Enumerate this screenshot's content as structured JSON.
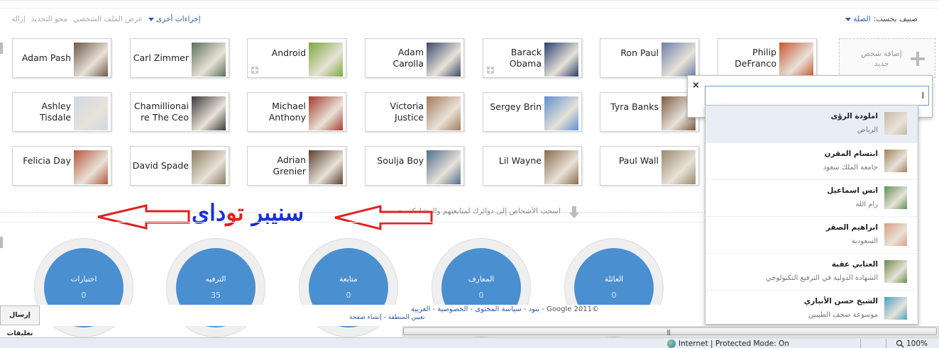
{
  "toolbar": {
    "actions": {
      "more_label": "إجراءات أخرى",
      "remove_label": "إزالة",
      "clear_label": "محو التحديد",
      "view_profile_label": "عرض الملف الشخصي"
    },
    "sort": {
      "label": "صنيف بحسب:",
      "value": "الصلة"
    }
  },
  "people_rows": [
    [
      {
        "name": "Adam Pash",
        "photo": "#6b5a4a"
      },
      {
        "name": "Carl Zimmer",
        "photo": "#5d6f5a"
      },
      {
        "name": "Android",
        "photo": "#7aa83c"
      },
      {
        "name": "Adam Carolla",
        "photo": "#3b4a6a"
      },
      {
        "name": "Barack Obama",
        "photo": "#2a3e70"
      },
      {
        "name": "Ron Paul",
        "photo": "#6a7fa8"
      },
      {
        "name": "Philip DeFranco",
        "photo": "#c7552f"
      }
    ],
    [
      {
        "name": "Ashley Tisdale",
        "photo": "#cfd9e6"
      },
      {
        "name": "Chamillionaire The Ceo",
        "photo": "#3a3a3a"
      },
      {
        "name": "Michael Anthony",
        "photo": "#a73b2e"
      },
      {
        "name": "Victoria Justice",
        "photo": "#a5785a"
      },
      {
        "name": "Sergey Brin",
        "photo": "#5c8fd1"
      },
      {
        "name": "Tyra Banks",
        "photo": "#7b5a44"
      }
    ],
    [
      {
        "name": "Felicia Day",
        "photo": "#b7553c"
      },
      {
        "name": "David Spade",
        "photo": "#8a7c60"
      },
      {
        "name": "Adrian Grenier",
        "photo": "#5a4030"
      },
      {
        "name": "Soulja Boy",
        "photo": "#4d6e8c"
      },
      {
        "name": "Lil Wayne",
        "photo": "#8c6a4a"
      },
      {
        "name": "Paul Wall",
        "photo": "#9a8a6a"
      }
    ]
  ],
  "add_person": {
    "label": "إضافة شخص جديد"
  },
  "hint_text": "اسحب الأشخاص إلى دوائرك لمتابعتهم والمشاركة معهم",
  "overlay_text": {
    "part1": "سنيبر",
    "part2": "تو",
    "part3": "داى",
    "color_blue": "#1a2fd6",
    "color_red": "#e02020"
  },
  "circles": [
    {
      "label": "اختيارات",
      "count": "0"
    },
    {
      "label": "الترفيه",
      "count": "35"
    },
    {
      "label": "متابعة",
      "count": "0"
    },
    {
      "label": "المعارف",
      "count": "0"
    },
    {
      "label": "العائلة",
      "count": "0"
    }
  ],
  "footer": {
    "copyright": "©2011 Google",
    "links": [
      "بنود",
      "سياسة المحتوى",
      "الخصوصية",
      "العربية",
      "تعيين المنطقة",
      "إنشاء صفحة"
    ]
  },
  "feedback_label": "إرسال تعليقات",
  "search": {
    "close": "×",
    "value": "ا"
  },
  "suggestions": [
    {
      "name": "املودة الرؤى",
      "detail": "الرياض",
      "avatar": "#c9b7a5"
    },
    {
      "name": "ابتسام المقرن",
      "detail": "جامعة الملك سعود",
      "avatar": "#a0825a"
    },
    {
      "name": "انس اسماعيل",
      "detail": "رام الله",
      "avatar": "#5f8f5a"
    },
    {
      "name": "ابراهيم الصقر",
      "detail": "السعودية",
      "avatar": "#d8a080"
    },
    {
      "name": "العتابي عقبة",
      "detail": "الشهادة الدولية في الترفيع التكنولوجي",
      "avatar": "#6a8a4a"
    },
    {
      "name": "الشيخ حسن الأنباري",
      "detail": "موسوعة صحف الطيبين",
      "avatar": "#4aa0c0"
    }
  ],
  "statusbar": {
    "zone": "Internet | Protected Mode: On",
    "zoom": "100%"
  }
}
